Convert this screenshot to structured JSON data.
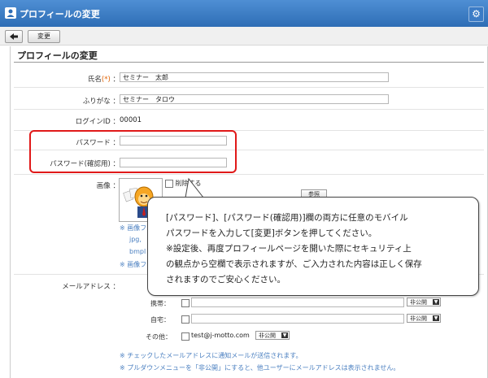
{
  "window": {
    "title": "プロフィールの変更"
  },
  "toolbar": {
    "back_label": "◆",
    "change_label": "変更"
  },
  "form": {
    "section_title": "プロフィールの変更",
    "fields": {
      "name": {
        "label": "氏名",
        "required_mark": "(*)",
        "colon": "：",
        "value": "セミナー　太郎"
      },
      "kana": {
        "label": "ふりがな",
        "colon": "：",
        "value": "セミナー　タロウ"
      },
      "login_id": {
        "label": "ログインID",
        "colon": "：",
        "value": "00001"
      },
      "password": {
        "label": "パスワード",
        "colon": "：",
        "value": ""
      },
      "password_confirm": {
        "label": "パスワード(確認用)",
        "colon": "：",
        "value": ""
      },
      "image": {
        "label": "画像",
        "colon": "：",
        "delete_label": "削除する",
        "browse_label": "参照",
        "note1": "※ 画像フ",
        "note2": "jpg,",
        "note3": "bmpl",
        "note4": "※ 画像フ"
      },
      "email": {
        "label": "メールアドレス",
        "colon": "：",
        "mobile": {
          "label": "携帯：",
          "value": "",
          "visibility": "非公開"
        },
        "home": {
          "label": "自宅：",
          "value": "",
          "visibility": "非公開"
        },
        "other": {
          "label": "その他：",
          "value": "test@j-motto.com",
          "visibility": "非公開"
        }
      }
    },
    "notes": [
      "※ チェックしたメールアドレスに通知メールが送信されます。",
      "※ プルダウンメニューを「非公開」にすると、他ユーザーにメールアドレスは表示されません。"
    ]
  },
  "callout": {
    "line1": "[パスワード]、[パスワード(確認用)]欄の両方に任意のモバイル",
    "line2": "パスワードを入力して[変更]ボタンを押してください。",
    "line3": "※設定後、再度プロフィールページを開いた際にセキュリティ上",
    "line4": "の観点から空欄で表示されますが、ご入力された内容は正しく保存",
    "line5": "されますのでご安心ください。"
  },
  "colors": {
    "titlebar": "#2e6db5",
    "highlight": "#e01919",
    "note_text": "#4a7fc0",
    "required": "#e06000"
  }
}
